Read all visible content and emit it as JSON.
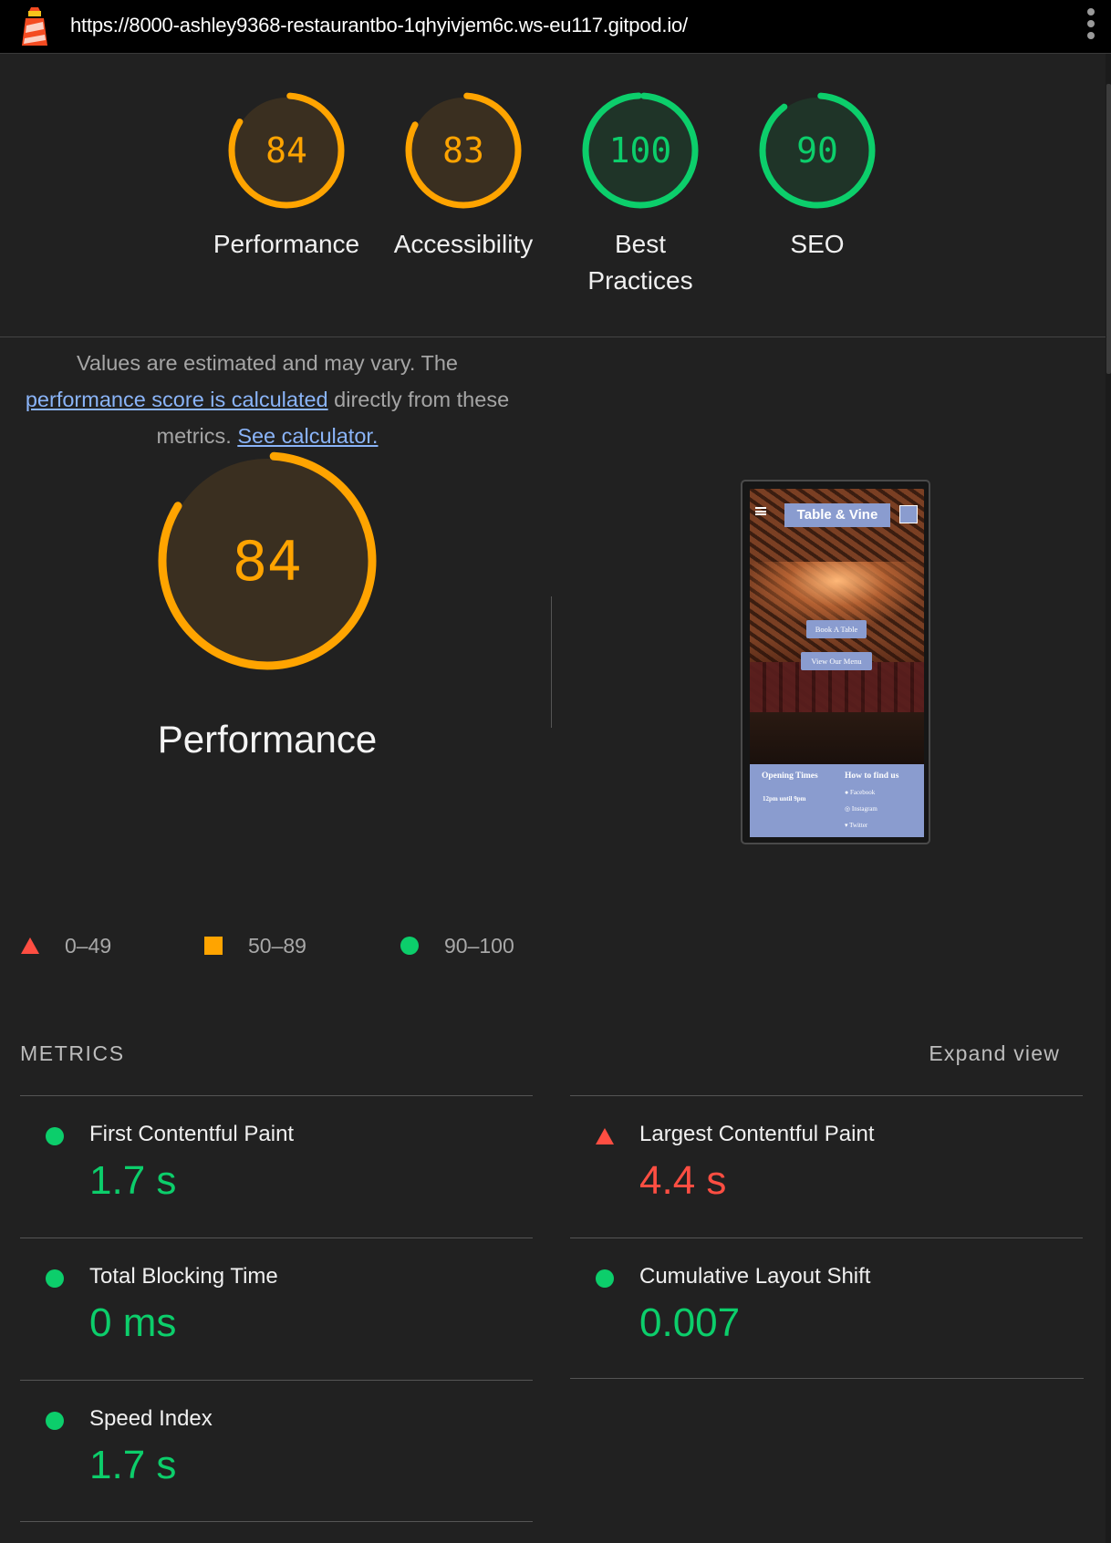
{
  "browser": {
    "url": "https://8000-ashley9368-restaurantbo-1qhyivjem6c.ws-eu117.gitpod.io/"
  },
  "colors": {
    "average": "#ffa400",
    "pass": "#0cce6b",
    "fail": "#ff4e42",
    "link": "#8ab4f8",
    "background": "#212121"
  },
  "gauges": [
    {
      "score": 84,
      "label": "Performance",
      "rating": "average"
    },
    {
      "score": 83,
      "label": "Accessibility",
      "rating": "average"
    },
    {
      "score": 100,
      "label_line1": "Best",
      "label_line2": "Practices",
      "rating": "pass"
    },
    {
      "score": 90,
      "label": "SEO",
      "rating": "pass"
    }
  ],
  "performance": {
    "score": 84,
    "title": "Performance",
    "desc_prefix": "Values are estimated and may vary. The",
    "desc_link": "performance score is calculated",
    "desc_mid": "directly from these metrics.",
    "desc_link2": "See calculator."
  },
  "legend": [
    {
      "range": "0–49",
      "icon": "red-triangle-icon"
    },
    {
      "range": "50–89",
      "icon": "orange-square-icon"
    },
    {
      "range": "90–100",
      "icon": "green-circle-icon"
    }
  ],
  "screenshot": {
    "brand": "Table & Vine",
    "button_book": "Book A Table",
    "button_menu": "View Our Menu",
    "footer_opening_title": "Opening Times",
    "footer_opening_hours": "12pm until 9pm",
    "footer_find_title": "How to find us",
    "footer_facebook": "Facebook",
    "footer_instagram": "Instagram",
    "footer_twitter": "Twitter"
  },
  "metrics": {
    "title": "METRICS",
    "expand_label": "Expand view",
    "items": [
      {
        "name": "First Contentful Paint",
        "value": "1.7 s",
        "status": "pass"
      },
      {
        "name": "Largest Contentful Paint",
        "value": "4.4 s",
        "status": "fail"
      },
      {
        "name": "Total Blocking Time",
        "value": "0 ms",
        "status": "pass"
      },
      {
        "name": "Cumulative Layout Shift",
        "value": "0.007",
        "status": "pass"
      },
      {
        "name": "Speed Index",
        "value": "1.7 s",
        "status": "pass"
      }
    ]
  }
}
